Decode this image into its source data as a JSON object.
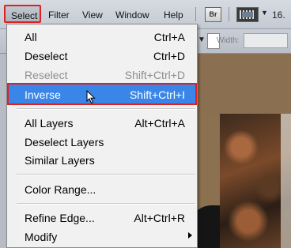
{
  "menubar": {
    "items": [
      {
        "label": "Select"
      },
      {
        "label": "Filter"
      },
      {
        "label": "View"
      },
      {
        "label": "Window"
      },
      {
        "label": "Help"
      }
    ],
    "br_label": "Br",
    "zoom_text": "16."
  },
  "options_bar": {
    "width_label": "Width:"
  },
  "select_menu": {
    "items": [
      {
        "label": "All",
        "shortcut": "Ctrl+A",
        "enabled": true
      },
      {
        "label": "Deselect",
        "shortcut": "Ctrl+D",
        "enabled": true
      },
      {
        "label": "Reselect",
        "shortcut": "Shift+Ctrl+D",
        "enabled": false
      },
      {
        "label": "Inverse",
        "shortcut": "Shift+Ctrl+I",
        "enabled": true,
        "highlighted": true
      },
      {
        "label": "All Layers",
        "shortcut": "Alt+Ctrl+A",
        "enabled": true
      },
      {
        "label": "Deselect Layers",
        "shortcut": "",
        "enabled": true
      },
      {
        "label": "Similar Layers",
        "shortcut": "",
        "enabled": true
      },
      {
        "label": "Color Range...",
        "shortcut": "",
        "enabled": true
      },
      {
        "label": "Refine Edge...",
        "shortcut": "Alt+Ctrl+R",
        "enabled": true
      },
      {
        "label": "Modify",
        "shortcut": "",
        "enabled": true,
        "submenu": true
      }
    ]
  },
  "colors": {
    "highlight": "#3a86e8",
    "annotation_red": "#e02020"
  }
}
